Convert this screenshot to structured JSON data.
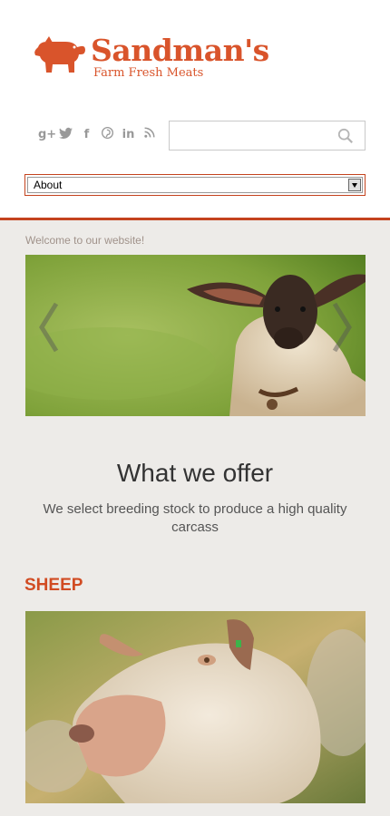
{
  "brand": {
    "name": "Sandman's",
    "tagline": "Farm Fresh Meats",
    "color": "#d9542b"
  },
  "social": [
    {
      "icon": "google-plus-icon",
      "glyph": "g+"
    },
    {
      "icon": "twitter-icon",
      "glyph": "t"
    },
    {
      "icon": "facebook-icon",
      "glyph": "f"
    },
    {
      "icon": "pinterest-icon",
      "glyph": "p"
    },
    {
      "icon": "linkedin-icon",
      "glyph": "in"
    },
    {
      "icon": "rss-icon",
      "glyph": "rss"
    }
  ],
  "search": {
    "placeholder": "",
    "value": ""
  },
  "nav": {
    "selected": "About"
  },
  "welcome": "Welcome to our website!",
  "offer": {
    "title": "What we offer",
    "subtitle": "We select breeding stock to produce a high quality carcass"
  },
  "section": {
    "title": "SHEEP"
  },
  "colors": {
    "accent": "#c4431e",
    "background": "#edebe8"
  }
}
